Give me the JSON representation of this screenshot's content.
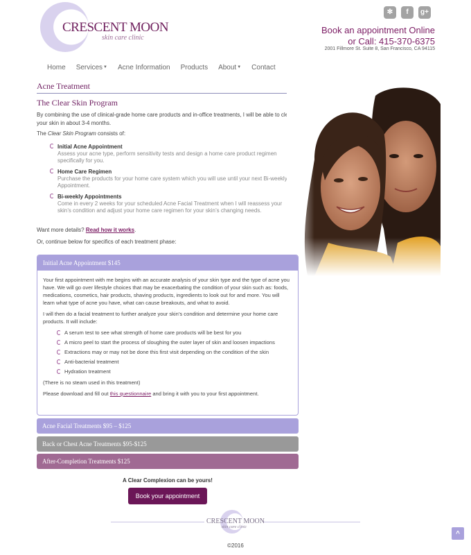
{
  "header": {
    "logo_name": "CRESCENT MOON",
    "logo_tagline": "skin care clinic",
    "social": [
      "yelp-icon",
      "facebook-icon",
      "google-plus-icon"
    ],
    "social_glyphs": [
      "✻",
      "f",
      "g+"
    ],
    "cta_line1": "Book an appointment Online",
    "cta_line2": "or Call: 415-370-6375",
    "address": "2001 Fillmore St. Suite 8, San Francisco, CA 94115"
  },
  "nav": {
    "items": [
      "Home",
      "Services",
      "Acne Information",
      "Products",
      "About",
      "Contact"
    ]
  },
  "main": {
    "page_title": "Acne Treatment",
    "section_title": "The Clear Skin Program",
    "intro": "By combining the use of clinical-grade home care products and in-office treatments, I will be able to clear your skin in about 3-4 months.",
    "consists_prefix": "The ",
    "consists_em": "Clear Skin Program",
    "consists_suffix": " consists of:",
    "steps": [
      {
        "title": "Initial Acne Appointment",
        "desc": "Assess your acne type, perform sensitivity tests and design a home care product regimen specifically for you."
      },
      {
        "title": "Home Care Regimen",
        "desc": "Purchase the products for your home care system which you will use until your next Bi-weekly Appointment."
      },
      {
        "title": "Bi-weekly Appointments",
        "desc": "Come in every 2 weeks for your scheduled Acne Facial Treatment when I will reassess your skin’s condition and adjust your home care regimen for your skin’s changing needs."
      }
    ],
    "more_prefix": "Want more details? ",
    "more_link": "Read how it works",
    "more_suffix": ".",
    "or_continue": "Or, continue below for specifics of each treatment phase:"
  },
  "accordion": {
    "open_title": "Initial Acne Appointment $145",
    "p1": "Your first appointment with me begins with an accurate analysis of your skin type and the type of acne you have. We will go over lifestyle choices that may be exacerbating the condition of your skin such as: foods, medications, cosmetics, hair products, shaving products, ingredients to look out for and more. You will learn what type of acne you have, what can cause breakouts, and what to avoid.",
    "p2": "I will then do a facial treatment to further analyze your skin’s condition and determine your home care products. It will include:",
    "checks": [
      "A serum test to see what strength of home care products will be best for you",
      "A micro peel to start the process of sloughing the outer layer of skin and loosen impactions",
      "Extractions may or may not be done this first visit depending on the condition of the skin",
      "Anti-bacterial treatment",
      "Hydration treatment"
    ],
    "note": "(There is no steam used in this treatment)",
    "download_prefix": "Please download and fill out ",
    "download_link": "this questionnaire",
    "download_suffix": " and bring it with you to your first appointment.",
    "closed": [
      "Acne Facial Treatments $95 – $125",
      "Back or Chest Acne Treatments $95-$125",
      "After-Completion Treatments $125"
    ]
  },
  "cta": {
    "tagline": "A Clear Complexion can be yours!",
    "button": "Book your appointment"
  },
  "footer": {
    "logo_name": "CRESCENT MOON",
    "logo_tagline": "skin care clinic",
    "copyright": "©2016",
    "top_glyph": "^"
  },
  "colors": {
    "brand": "#6b1657",
    "accordion_open": "#a9a1dc",
    "accordion_gray": "#999999",
    "accordion_mauve": "#a06a93"
  }
}
